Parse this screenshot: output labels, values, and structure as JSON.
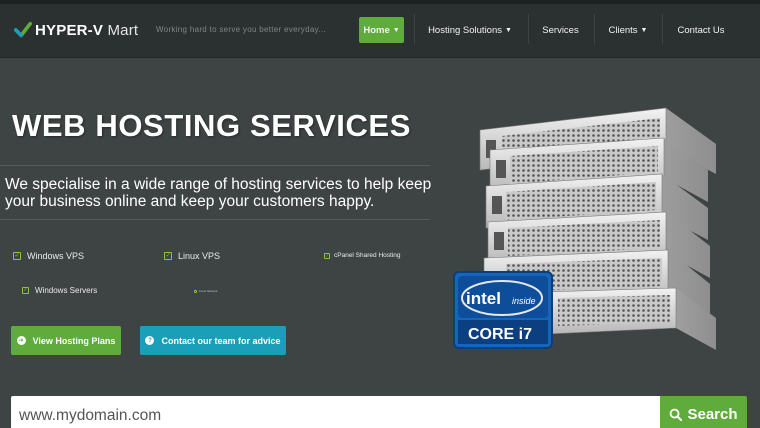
{
  "brand": {
    "name_bold": "HYPER-V",
    "name_light": "Mart",
    "tagline": "Working hard to serve you better everyday..."
  },
  "nav": {
    "home": "Home",
    "hosting_solutions": "Hosting Solutions",
    "services": "Services",
    "clients": "Clients",
    "contact": "Contact Us"
  },
  "hero": {
    "title": "WEB HOSTING SERVICES",
    "description": "We specialise in a wide range of hosting services to help keep your business online and keep your customers happy."
  },
  "features": {
    "windows_vps": "Windows VPS",
    "linux_vps": "Linux VPS",
    "cpanel": "cPanel Shared Hosting",
    "windows_servers": "Windows Servers",
    "linux_servers": "Linux Servers"
  },
  "buttons": {
    "view_plans": "View Hosting Plans",
    "contact_team": "Contact our team for advice"
  },
  "badge": {
    "brand": "intel",
    "inside": "inside",
    "product": "CORE i7"
  },
  "search": {
    "value": "www.mydomain.com",
    "button": "Search"
  },
  "colors": {
    "accent_green": "#5fac3c",
    "accent_teal": "#1b9fb8",
    "background": "#3e4443",
    "header": "#2b3030"
  }
}
